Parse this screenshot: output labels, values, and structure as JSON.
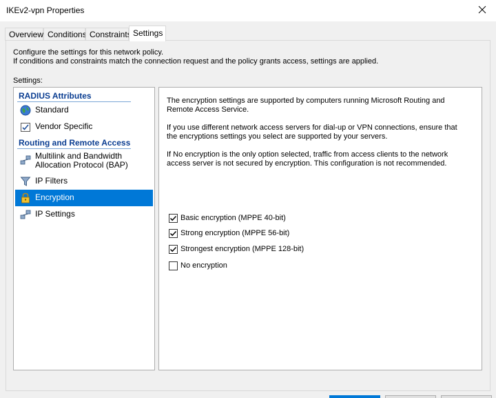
{
  "window": {
    "title": "IKEv2-vpn Properties"
  },
  "tabs": [
    {
      "label": "Overview"
    },
    {
      "label": "Conditions"
    },
    {
      "label": "Constraints"
    },
    {
      "label": "Settings"
    }
  ],
  "description": {
    "line1": "Configure the settings for this network policy.",
    "line2": "If conditions and constraints match the connection request and the policy grants access, settings are applied."
  },
  "settings_label": "Settings:",
  "sidebar": {
    "radius_header": "RADIUS Attributes",
    "routing_header": "Routing and Remote Access",
    "items": [
      {
        "label": "Standard",
        "icon": "globe-icon"
      },
      {
        "label": "Vendor Specific",
        "icon": "checklist-icon"
      },
      {
        "label_line1": "Multilink and Bandwidth",
        "label_line2": "Allocation Protocol (BAP)",
        "icon": "network-icon"
      },
      {
        "label": "IP Filters",
        "icon": "filter-icon"
      },
      {
        "label": "Encryption",
        "icon": "lock-icon"
      },
      {
        "label": "IP Settings",
        "icon": "network-icon"
      }
    ],
    "selected": "Encryption"
  },
  "content": {
    "para1_line1": "The encryption settings are supported by computers running Microsoft Routing and",
    "para1_line2": "Remote Access Service.",
    "para2_line1": "If you use different network access servers for dial-up or VPN connections, ensure that",
    "para2_line2": "the encryptions settings you select are supported by your servers.",
    "para3_line1": "If No encryption is the only option selected, traffic from access clients to the network",
    "para3_line2": "access server is not secured by encryption. This configuration is not recommended.",
    "options": [
      {
        "label": "Basic encryption (MPPE 40-bit)",
        "checked": true
      },
      {
        "label": "Strong encryption (MPPE 56-bit)",
        "checked": true
      },
      {
        "label": "Strongest encryption (MPPE 128-bit)",
        "checked": true
      },
      {
        "label": "No encryption",
        "checked": false
      }
    ]
  },
  "colors": {
    "selection": "#0078d7",
    "section_header": "#0a3d91"
  }
}
